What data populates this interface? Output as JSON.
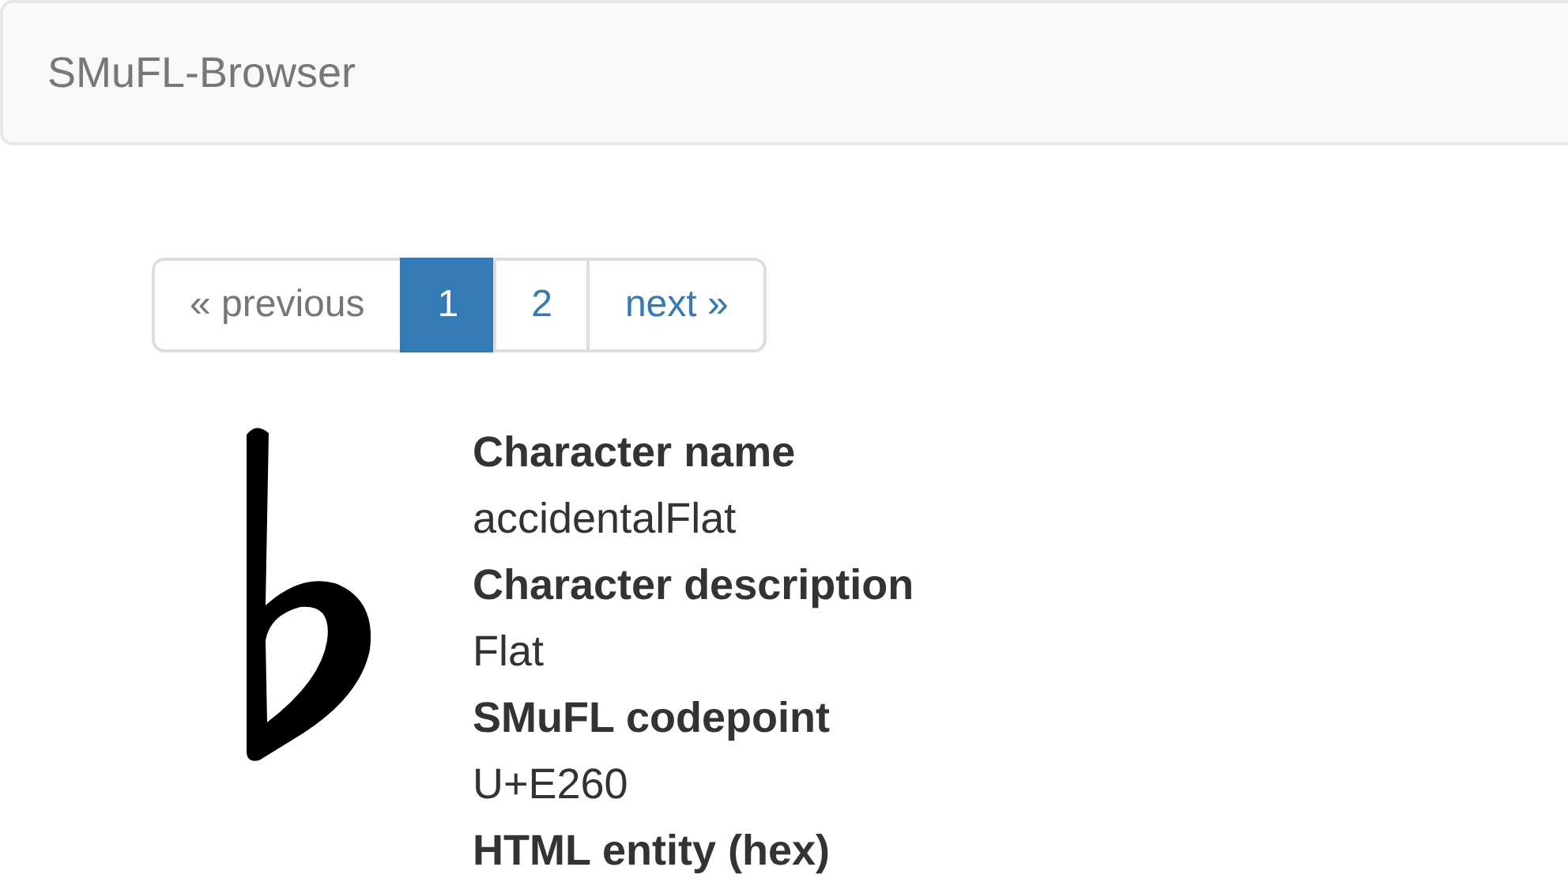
{
  "navbar": {
    "brand": "SMuFL-Browser"
  },
  "pagination": [
    {
      "label": "« previous",
      "selected": false,
      "disabled": true
    },
    {
      "label": "1",
      "selected": true,
      "disabled": false
    },
    {
      "label": "2",
      "selected": false,
      "disabled": false
    },
    {
      "label": "next »",
      "selected": false,
      "disabled": false
    }
  ],
  "glyph": {
    "kind": "flat"
  },
  "details": [
    {
      "label": "Character name",
      "value": "accidentalFlat"
    },
    {
      "label": "Character description",
      "value": "Flat"
    },
    {
      "label": "SMuFL codepoint",
      "value": "U+E260"
    },
    {
      "label": "HTML entity (hex)"
    }
  ]
}
